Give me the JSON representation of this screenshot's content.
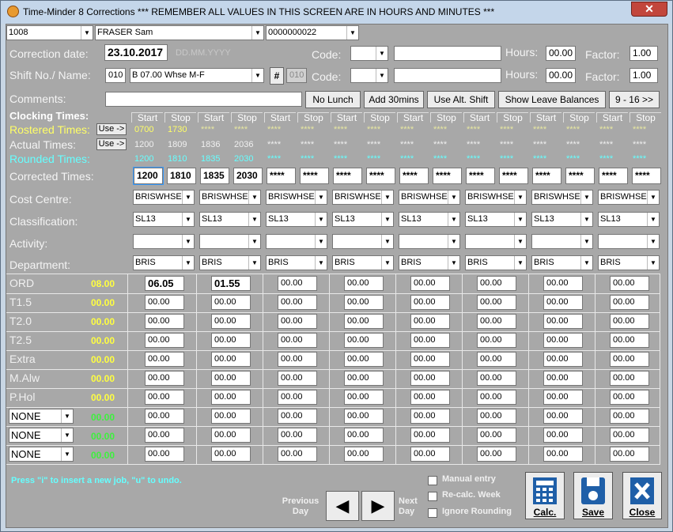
{
  "window": {
    "title": "Time-Minder 8 Corrections *** REMEMBER ALL VALUES IN THIS SCREEN ARE IN HOURS AND MINUTES ***",
    "close": "✕"
  },
  "header": {
    "employee_no": "1008",
    "employee_name": "FRASER Sam",
    "card_no": "0000000022"
  },
  "correction": {
    "label": "Correction date:",
    "date": "23.10.2017",
    "date_hint": "DD.MM.YYYY"
  },
  "shift": {
    "label": "Shift No./ Name:",
    "number": "010",
    "name": "B 07.00 Whse M-F",
    "hash": "#",
    "number2": "010"
  },
  "code_rows": [
    {
      "code_label": "Code:",
      "hours_label": "Hours:",
      "hours": "00.00",
      "factor_label": "Factor:",
      "factor": "1.00"
    },
    {
      "code_label": "Code:",
      "hours_label": "Hours:",
      "hours": "00.00",
      "factor_label": "Factor:",
      "factor": "1.00"
    }
  ],
  "comments": {
    "label": "Comments:"
  },
  "buttons": {
    "no_lunch": "No Lunch",
    "add30": "Add 30mins",
    "use_alt": "Use Alt. Shift",
    "show_leave": "Show Leave Balances",
    "range": "9 - 16 >>"
  },
  "clocking": {
    "label": "Clocking Times:",
    "start": "Start",
    "stop": "Stop",
    "rostered_label": "Rostered Times:",
    "use_label": "Use ->",
    "actual_label": "Actual Times:",
    "rounded_label": "Rounded Times:",
    "corrected_label": "Corrected Times:",
    "rostered": [
      "0700",
      "1730",
      "****",
      "****",
      "****",
      "****",
      "****",
      "****",
      "****",
      "****",
      "****",
      "****",
      "****",
      "****",
      "****",
      "****"
    ],
    "actual": [
      "1200",
      "1809",
      "1836",
      "2036",
      "****",
      "****",
      "****",
      "****",
      "****",
      "****",
      "****",
      "****",
      "****",
      "****",
      "****",
      "****"
    ],
    "rounded": [
      "1200",
      "1810",
      "1835",
      "2030",
      "****",
      "****",
      "****",
      "****",
      "****",
      "****",
      "****",
      "****",
      "****",
      "****",
      "****",
      "****"
    ],
    "corrected": [
      "1200",
      "1810",
      "1835",
      "2030",
      "****",
      "****",
      "****",
      "****",
      "****",
      "****",
      "****",
      "****",
      "****",
      "****",
      "****",
      "****"
    ]
  },
  "rows": {
    "cost_centre": "Cost Centre:",
    "classification": "Classification:",
    "activity": "Activity:",
    "department": "Department:"
  },
  "job": {
    "cost_centre": "BRISWHSE",
    "classification": "SL13",
    "activity": "",
    "department": "BRIS"
  },
  "hours_rows": [
    {
      "label": "ORD",
      "total": "08.00",
      "values": [
        "06.05",
        "01.55",
        "00.00",
        "00.00",
        "00.00",
        "00.00",
        "00.00",
        "00.00"
      ]
    },
    {
      "label": "T1.5",
      "total": "00.00",
      "values": [
        "00.00",
        "00.00",
        "00.00",
        "00.00",
        "00.00",
        "00.00",
        "00.00",
        "00.00"
      ]
    },
    {
      "label": "T2.0",
      "total": "00.00",
      "values": [
        "00.00",
        "00.00",
        "00.00",
        "00.00",
        "00.00",
        "00.00",
        "00.00",
        "00.00"
      ]
    },
    {
      "label": "T2.5",
      "total": "00.00",
      "values": [
        "00.00",
        "00.00",
        "00.00",
        "00.00",
        "00.00",
        "00.00",
        "00.00",
        "00.00"
      ]
    },
    {
      "label": "Extra",
      "total": "00.00",
      "values": [
        "00.00",
        "00.00",
        "00.00",
        "00.00",
        "00.00",
        "00.00",
        "00.00",
        "00.00"
      ]
    },
    {
      "label": "M.Alw",
      "total": "00.00",
      "values": [
        "00.00",
        "00.00",
        "00.00",
        "00.00",
        "00.00",
        "00.00",
        "00.00",
        "00.00"
      ]
    },
    {
      "label": "P.Hol",
      "total": "00.00",
      "values": [
        "00.00",
        "00.00",
        "00.00",
        "00.00",
        "00.00",
        "00.00",
        "00.00",
        "00.00"
      ]
    }
  ],
  "none_rows": [
    {
      "select": "NONE",
      "total": "00.00",
      "values": [
        "00.00",
        "00.00",
        "00.00",
        "00.00",
        "00.00",
        "00.00",
        "00.00",
        "00.00"
      ]
    },
    {
      "select": "NONE",
      "total": "00.00",
      "values": [
        "00.00",
        "00.00",
        "00.00",
        "00.00",
        "00.00",
        "00.00",
        "00.00",
        "00.00"
      ]
    },
    {
      "select": "NONE",
      "total": "00.00",
      "values": [
        "00.00",
        "00.00",
        "00.00",
        "00.00",
        "00.00",
        "00.00",
        "00.00",
        "00.00"
      ]
    }
  ],
  "footer": {
    "hint": "Press \"i\" to insert a new job, \"u\" to undo.",
    "prev": "Previous Day",
    "next": "Next Day",
    "manual": "Manual entry",
    "recalc": "Re-calc. Week",
    "ignore": "Ignore Rounding",
    "calc": "Calc.",
    "save": "Save",
    "close": "Close"
  },
  "colors": {
    "rostered": "#ffff66",
    "rounded": "#66ffff",
    "yellow_total": "#ffff40",
    "green_total": "#3ef03e",
    "hint": "#66ffff"
  }
}
